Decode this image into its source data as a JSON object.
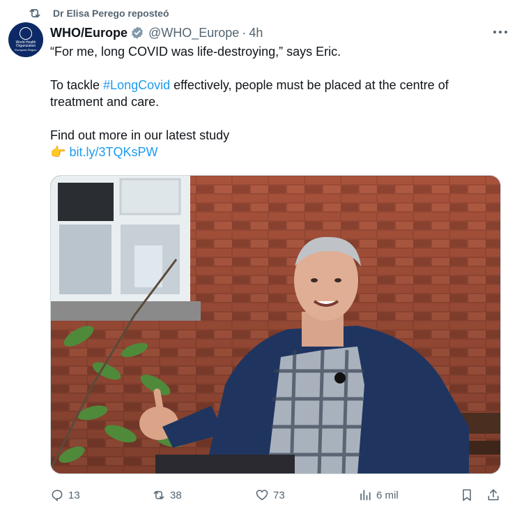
{
  "repost": {
    "text": "Dr Elisa Perego reposteó",
    "icon": "repost-icon"
  },
  "author": {
    "avatar_line1": "World Health Organization",
    "avatar_line2": "European Region",
    "name": "WHO/Europe",
    "handle": "@WHO_Europe",
    "time": "4h",
    "verified_color": "#829aab"
  },
  "tweet": {
    "line1": "“For me, long COVID was life-destroying,” says Eric.",
    "line2_prefix": "To tackle ",
    "hashtag": "#LongCovid",
    "line2_suffix": " effectively, people must be placed at the centre of",
    "line3": "treatment and care.",
    "line4": "Find out more in our latest study",
    "emoji": "👉",
    "url": "bit.ly/3TQKsPW"
  },
  "media": {
    "icon": "photo-of-man-on-bench"
  },
  "actions": {
    "replies": "13",
    "reposts": "38",
    "likes": "73",
    "views": "6 mil"
  },
  "colors": {
    "link": "#1d9bf0",
    "muted": "#536471",
    "text": "#0f1419"
  }
}
